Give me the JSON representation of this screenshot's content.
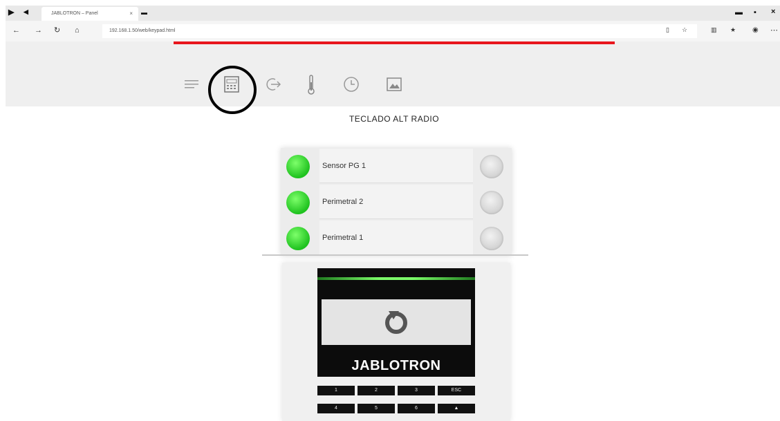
{
  "browser": {
    "tab_title": "JABLOTRON – Panel",
    "tab_close": "×",
    "new_tab": "▬",
    "address": "192.168.1.50/web/keypad.html",
    "window_minimize": "▬",
    "window_restore": "▪",
    "window_close": "×"
  },
  "toolbar": {
    "icons": [
      "menu-icon",
      "keypad-icon",
      "logout-icon",
      "thermometer-icon",
      "clock-icon",
      "image-icon"
    ]
  },
  "page": {
    "title": "TECLADO ALT RADIO"
  },
  "segments": [
    {
      "label": "Sensor PG 1",
      "led": "green"
    },
    {
      "label": "Perimetral 2",
      "led": "green"
    },
    {
      "label": "Perimetral 1",
      "led": "green"
    }
  ],
  "keypad": {
    "brand": "JABLOTRON",
    "keys_row1": [
      "1",
      "2",
      "3",
      "ESC"
    ],
    "keys_row2": [
      "4",
      "5",
      "6",
      "▲"
    ]
  },
  "colors": {
    "progress": "#e8161d",
    "led_on": "#2fd02f"
  }
}
